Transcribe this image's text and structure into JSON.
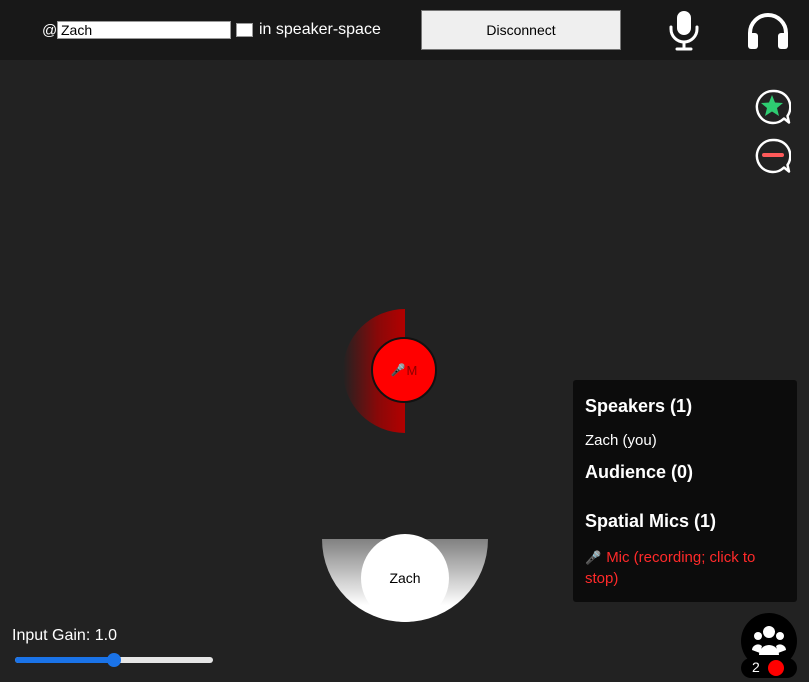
{
  "header": {
    "at_symbol": "@",
    "username_value": "Zach",
    "space_value": "",
    "space_suffix": "in speaker-space",
    "disconnect_label": "Disconnect",
    "icons": {
      "mic": "microphone-icon",
      "headphones": "headphones-icon"
    }
  },
  "side_controls": {
    "icons": [
      "star-bubble-icon",
      "minus-bubble-icon"
    ],
    "colors": {
      "star": "#2ecc71",
      "minus": "#ff5a5a"
    }
  },
  "stage": {
    "mic_avatar": {
      "glyph": "🎤",
      "label": "M",
      "color": "#ff0000"
    },
    "user_avatar": {
      "label": "Zach"
    }
  },
  "panel": {
    "speakers_title": "Speakers (1)",
    "speakers": [
      "Zach (you)"
    ],
    "audience_title": "Audience (0)",
    "mics_title": "Spatial Mics (1)",
    "mic_item": {
      "glyph": "🎤",
      "label": "Mic (recording; click to stop)",
      "color": "#ff2a2a"
    }
  },
  "input_gain": {
    "label": "Input Gain: 1.0",
    "value": 1.0,
    "fraction": 0.5,
    "accent": "#1a73e8"
  },
  "participants": {
    "count": "2",
    "recording_color": "#ff0000"
  }
}
